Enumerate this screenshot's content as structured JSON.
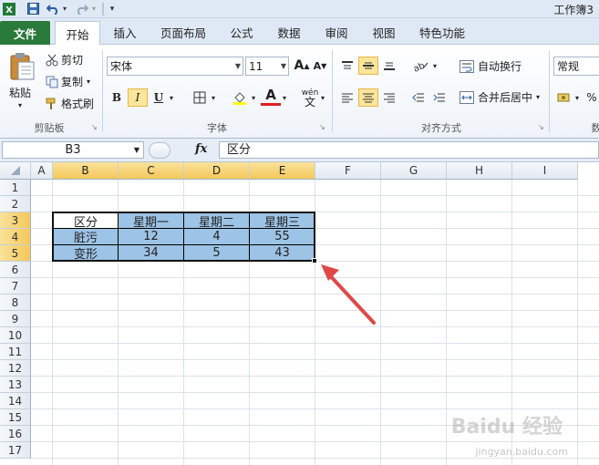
{
  "app": {
    "title": "工作簿3"
  },
  "ribbon_tabs": [
    "文件",
    "开始",
    "插入",
    "页面布局",
    "公式",
    "数据",
    "审阅",
    "视图",
    "特色功能"
  ],
  "clipboard": {
    "paste": "粘贴",
    "cut": "剪切",
    "copy": "复制",
    "format_painter": "格式刷",
    "group": "剪贴板"
  },
  "font": {
    "name": "宋体",
    "size": "11",
    "group": "字体",
    "grow": "A",
    "shrink": "A",
    "bold": "B",
    "italic": "I",
    "underline": "U",
    "color": "A",
    "phonetic": "wén"
  },
  "alignment": {
    "wrap_text": "自动换行",
    "merge_center": "合并后居中",
    "group": "对齐方式"
  },
  "number": {
    "format": "常规",
    "percent": "%",
    "group_partial": "数"
  },
  "formula_bar": {
    "name_box": "B3",
    "fx": "fx",
    "content": "区分"
  },
  "columns": [
    "A",
    "B",
    "C",
    "D",
    "E",
    "F",
    "G",
    "H",
    "I"
  ],
  "rows": [
    "1",
    "2",
    "3",
    "4",
    "5",
    "6",
    "7",
    "8",
    "9",
    "10",
    "11",
    "12",
    "13",
    "14",
    "15",
    "16",
    "17"
  ],
  "table": {
    "headers": [
      "区分",
      "星期一",
      "星期二",
      "星期三"
    ],
    "rows": [
      [
        "脏污",
        "12",
        "4",
        "55"
      ],
      [
        "变形",
        "34",
        "5",
        "43"
      ]
    ]
  },
  "watermark": {
    "main": "Baidu 经验",
    "sub": "jingyan.baidu.com"
  },
  "colors": {
    "file_tab": "#2a7a3b",
    "cell_fill": "#9dc3e6",
    "arrow": "#e04848",
    "selected_header": "#f3c85a"
  }
}
